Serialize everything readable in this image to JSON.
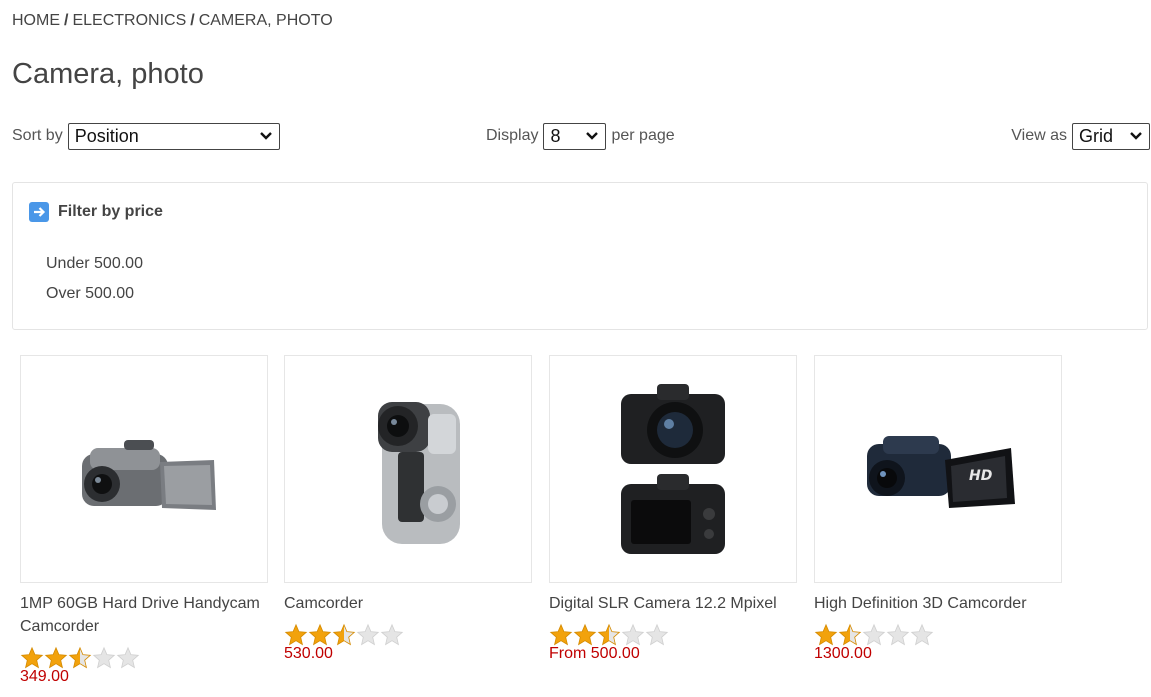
{
  "breadcrumb": {
    "items": [
      "HOME",
      "ELECTRONICS",
      "CAMERA, PHOTO"
    ],
    "separator": "/"
  },
  "page_title": "Camera, photo",
  "toolbar": {
    "sort_label": "Sort by",
    "sort_value": "Position",
    "display_label": "Display",
    "display_value": "8",
    "per_page_label": "per page",
    "view_label": "View as",
    "view_value": "Grid"
  },
  "filter": {
    "title": "Filter by price",
    "options": [
      "Under 500.00",
      "Over 500.00"
    ]
  },
  "products": [
    {
      "name": "1MP 60GB Hard Drive Handycam Camcorder",
      "rating": 2.5,
      "price": "349.00",
      "image_icon": "handycam-camcorder-image"
    },
    {
      "name": "Camcorder",
      "rating": 2.5,
      "price": "530.00",
      "image_icon": "camcorder-image"
    },
    {
      "name": "Digital SLR Camera 12.2 Mpixel",
      "rating": 2.5,
      "price": "From 500.00",
      "image_icon": "dslr-camera-image"
    },
    {
      "name": "High Definition 3D Camcorder",
      "rating": 1.5,
      "price": "1300.00",
      "image_icon": "hd-camcorder-image"
    }
  ],
  "colors": {
    "price": "#c00000",
    "star_filled": "#f2a20c",
    "star_empty": "#e5e5e5",
    "filter_icon": "#4a97e8"
  }
}
